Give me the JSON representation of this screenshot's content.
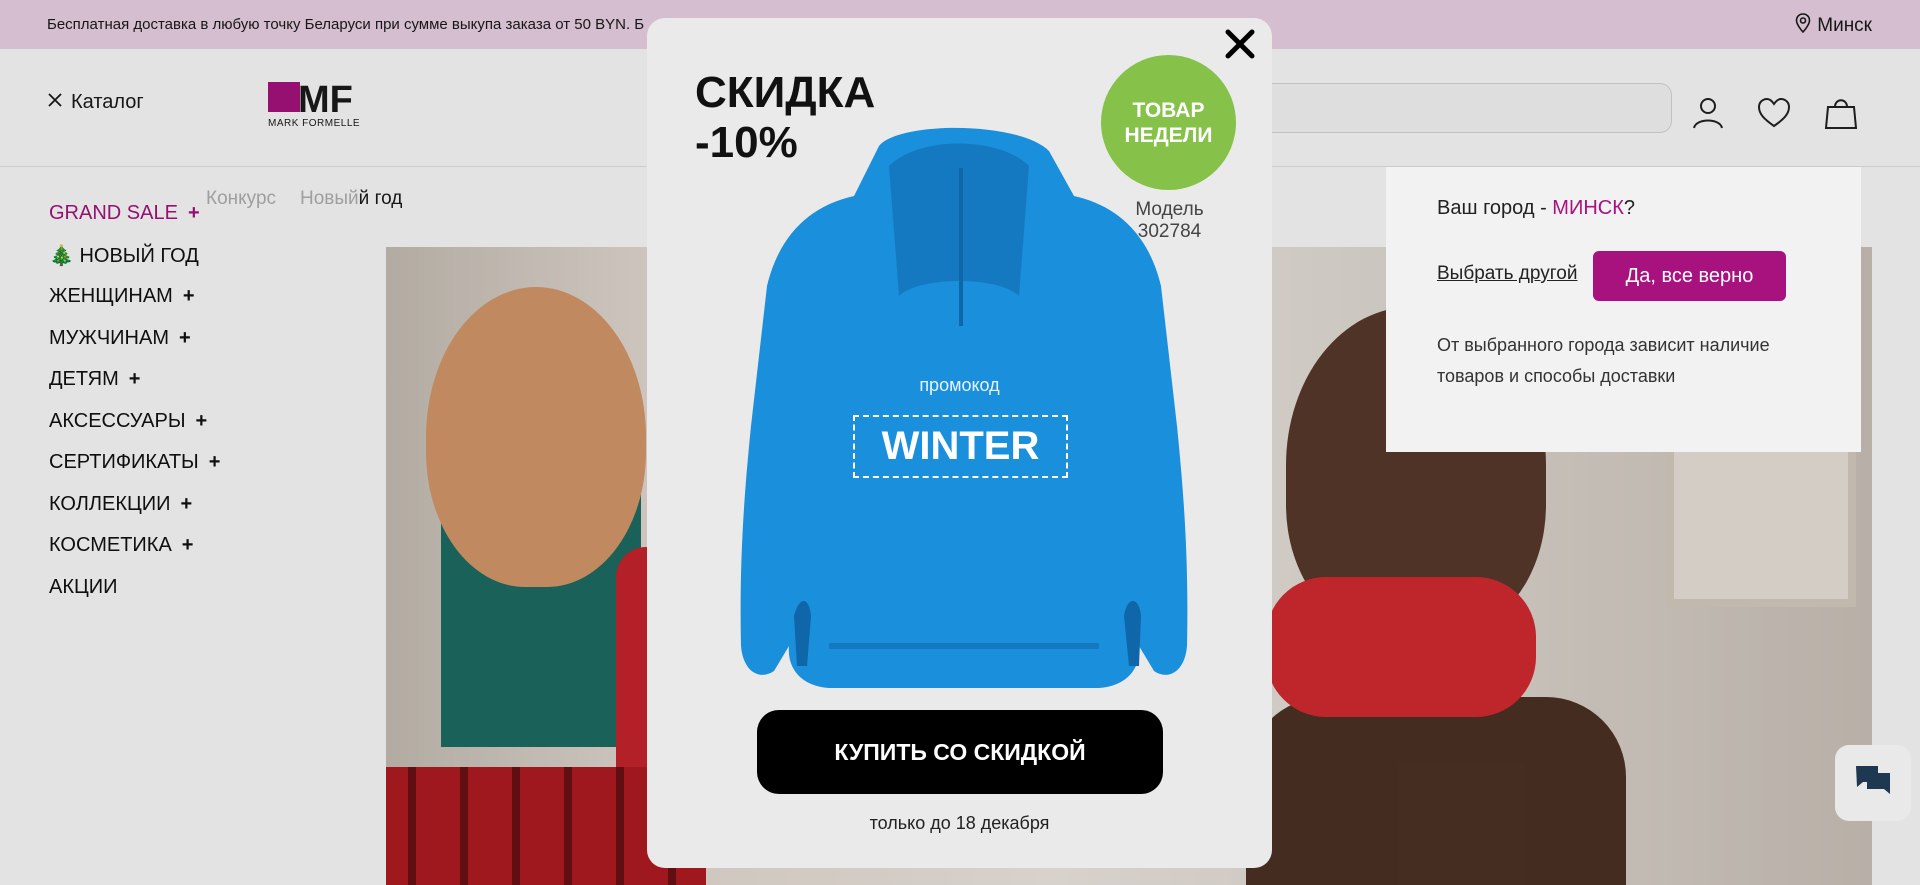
{
  "topbar": {
    "shipping_text": "Бесплатная доставка в любую точку Беларуси при сумме выкупа заказа от 50 BYN. Б",
    "city": "Минск"
  },
  "header": {
    "catalog_label": "Каталог",
    "logo_text": "MF",
    "logo_subtitle": "MARK FORMELLE"
  },
  "sublinks": [
    "Конкурс",
    "Новый",
    "й год"
  ],
  "menu": {
    "items": [
      {
        "label": "GRAND SALE",
        "plus": "+"
      },
      {
        "label": "🎄 НОВЫЙ ГОД",
        "plus": ""
      },
      {
        "label": "ЖЕНЩИНАМ",
        "plus": "+"
      },
      {
        "label": "МУЖЧИНАМ",
        "plus": "+"
      },
      {
        "label": "ДЕТЯМ",
        "plus": "+"
      },
      {
        "label": "АКСЕССУАРЫ",
        "plus": "+"
      },
      {
        "label": "СЕРТИФИКАТЫ",
        "plus": "+"
      },
      {
        "label": "КОЛЛЕКЦИИ",
        "plus": "+"
      },
      {
        "label": "КОСМЕТИКА",
        "plus": "+"
      },
      {
        "label": "АКЦИИ",
        "plus": ""
      }
    ]
  },
  "city_popup": {
    "question_prefix": "Ваш город - ",
    "city_name": "МИНСК",
    "question_suffix": "?",
    "choose_other": "Выбрать другой",
    "confirm": "Да, все верно",
    "note": "От выбранного города зависит наличие товаров и способы доставки"
  },
  "promo": {
    "title_line1": "СКИДКА",
    "title_line2": "-10%",
    "badge_line1": "ТОВАР",
    "badge_line2": "НЕДЕЛИ",
    "model_label": "Модель",
    "model_number": "302784",
    "promo_label": "промокод",
    "promo_code": "WINTER",
    "buy_button": "КУПИТЬ СО СКИДКОЙ",
    "until_text": "только до 18 декабря"
  },
  "colors": {
    "accent": "#a8127f",
    "topbar_bg": "#efd6ea",
    "badge_green": "#86c24a",
    "hoodie_blue": "#1a8fdc"
  },
  "icons": [
    "location-pin-icon",
    "close-icon",
    "user-icon",
    "heart-icon",
    "bag-icon",
    "chat-icon"
  ]
}
